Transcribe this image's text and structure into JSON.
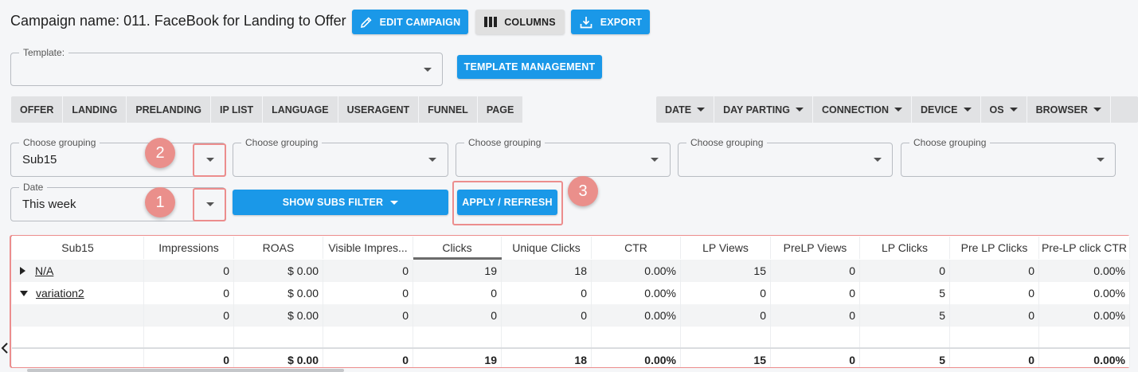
{
  "header": {
    "title": "Campaign name: 011. FaceBook for Landing to Offer",
    "edit_label": "EDIT CAMPAIGN",
    "columns_label": "COLUMNS",
    "export_label": "EXPORT"
  },
  "template": {
    "label": "Template:",
    "value": "",
    "management_label": "TEMPLATE MANAGEMENT"
  },
  "left_tabs": [
    "OFFER",
    "LANDING",
    "PRELANDING",
    "IP LIST",
    "LANGUAGE",
    "USERAGENT",
    "FUNNEL",
    "PAGE"
  ],
  "right_tabs": [
    "DATE",
    "DAY PARTING",
    "CONNECTION",
    "DEVICE",
    "OS",
    "BROWSER"
  ],
  "groupings": [
    {
      "label": "Choose grouping",
      "value": "Sub15"
    },
    {
      "label": "Choose grouping",
      "value": ""
    },
    {
      "label": "Choose grouping",
      "value": ""
    },
    {
      "label": "Choose grouping",
      "value": ""
    },
    {
      "label": "Choose grouping",
      "value": ""
    }
  ],
  "date": {
    "label": "Date",
    "value": "This week"
  },
  "show_subs_label": "SHOW SUBS FILTER",
  "apply_label": "APPLY / REFRESH",
  "annotations": [
    "2",
    "1",
    "3"
  ],
  "table": {
    "columns": [
      "Sub15",
      "Impressions",
      "ROAS",
      "Visible Impres...",
      "Clicks",
      "Unique Clicks",
      "CTR",
      "LP Views",
      "PreLP Views",
      "LP Clicks",
      "Pre LP Clicks",
      "Pre-LP click CTR"
    ],
    "rows": [
      [
        "N/A",
        "0",
        "$ 0.00",
        "0",
        "19",
        "18",
        "0.00%",
        "15",
        "0",
        "0",
        "0",
        "0.00%"
      ],
      [
        "variation2",
        "0",
        "$ 0.00",
        "0",
        "0",
        "0",
        "0.00%",
        "0",
        "0",
        "5",
        "0",
        "0.00%"
      ],
      [
        "",
        "0",
        "$ 0.00",
        "0",
        "0",
        "0",
        "0.00%",
        "0",
        "0",
        "5",
        "0",
        "0.00%"
      ]
    ],
    "totals": [
      "",
      "0",
      "$ 0.00",
      "0",
      "19",
      "18",
      "0.00%",
      "15",
      "0",
      "5",
      "0",
      "0.00%"
    ]
  },
  "colors": {
    "accent": "#1a98e8",
    "annotation": "#ea8f8b"
  }
}
